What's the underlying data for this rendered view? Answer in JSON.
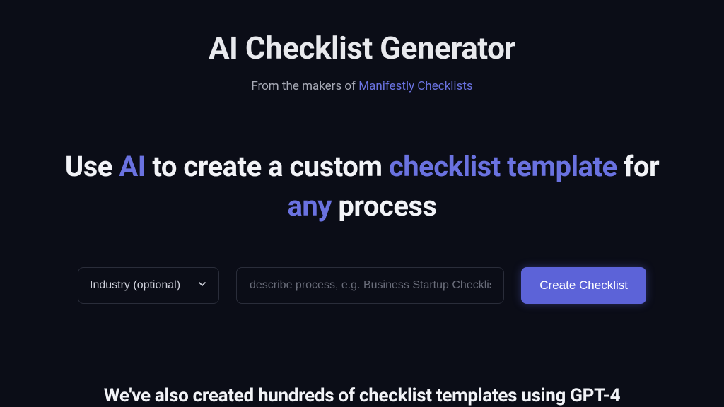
{
  "header": {
    "title": "AI Checklist Generator",
    "subtitle_prefix": "From the makers of ",
    "subtitle_link": "Manifestly Checklists"
  },
  "headline": {
    "part1": "Use ",
    "hl1": "AI",
    "part2": " to create a custom ",
    "hl2": "checklist template",
    "part3": " for ",
    "hl3": "any",
    "part4": " process"
  },
  "form": {
    "industry_label": "Industry (optional)",
    "process_placeholder": "describe process, e.g. Business Startup Checklist, Tra",
    "create_button": "Create Checklist"
  },
  "bottom": {
    "text": "We've also created hundreds of checklist templates using GPT-4"
  }
}
